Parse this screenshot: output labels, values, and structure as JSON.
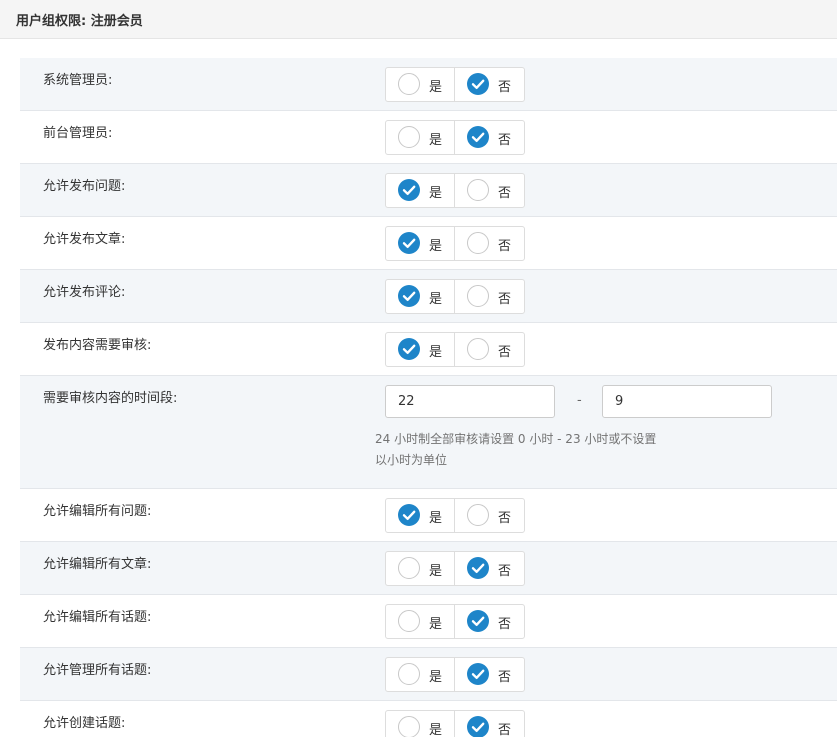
{
  "header": {
    "title": "用户组权限: 注册会员"
  },
  "permissions": [
    {
      "label": "系统管理员:",
      "yes": "是",
      "no": "否",
      "value": "no"
    },
    {
      "label": "前台管理员:",
      "yes": "是",
      "no": "否",
      "value": "no"
    },
    {
      "label": "允许发布问题:",
      "yes": "是",
      "no": "否",
      "value": "yes"
    },
    {
      "label": "允许发布文章:",
      "yes": "是",
      "no": "否",
      "value": "yes"
    },
    {
      "label": "允许发布评论:",
      "yes": "是",
      "no": "否",
      "value": "yes"
    },
    {
      "label": "发布内容需要审核:",
      "yes": "是",
      "no": "否",
      "value": "yes"
    }
  ],
  "review_time": {
    "label": "需要审核内容的时间段:",
    "start_value": "22",
    "separator": "-",
    "end_value": "9",
    "help_line1": "24 小时制全部审核请设置 0 小时 - 23 小时或不设置",
    "help_line2": "以小时为单位"
  },
  "permissions_more": [
    {
      "label": "允许编辑所有问题:",
      "yes": "是",
      "no": "否",
      "value": "yes"
    },
    {
      "label": "允许编辑所有文章:",
      "yes": "是",
      "no": "否",
      "value": "no"
    },
    {
      "label": "允许编辑所有话题:",
      "yes": "是",
      "no": "否",
      "value": "no"
    },
    {
      "label": "允许管理所有话题:",
      "yes": "是",
      "no": "否",
      "value": "no"
    },
    {
      "label": "允许创建话题:",
      "yes": "是",
      "no": "否",
      "value": "no"
    }
  ],
  "colors": {
    "accent": "#1e85c9",
    "row_alt": "#f3f6f9",
    "border": "#dddddd"
  }
}
